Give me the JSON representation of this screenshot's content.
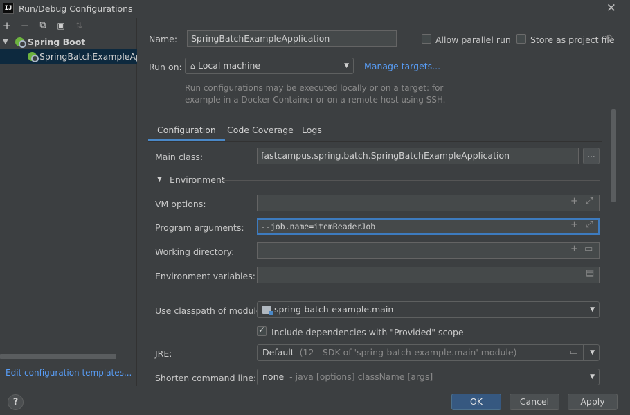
{
  "window": {
    "title": "Run/Debug Configurations",
    "app_icon_text": "IJ",
    "close_label": "✕"
  },
  "left_panel": {
    "toolbar": {
      "add": "+",
      "remove": "−",
      "copy": "⧉",
      "new_folder": "▣",
      "sort": "⇅"
    },
    "tree": {
      "group_label": "Spring Boot",
      "items": [
        {
          "label": "SpringBatchExampleApplication",
          "selected": true
        }
      ]
    },
    "edit_templates_link": "Edit configuration templates..."
  },
  "header": {
    "name_label": "Name:",
    "name_value": "SpringBatchExampleApplication",
    "allow_parallel_label": "Allow parallel run",
    "allow_parallel_checked": false,
    "store_project_label": "Store as project file",
    "store_project_checked": false,
    "run_on_label": "Run on:",
    "run_on_value": "Local machine",
    "manage_targets_link": "Manage targets...",
    "hint_line1": "Run configurations may be executed locally or on a target: for",
    "hint_line2": "example in a Docker Container or on a remote host using SSH."
  },
  "tabs": [
    {
      "label": "Configuration",
      "active": true
    },
    {
      "label": "Code Coverage",
      "active": false
    },
    {
      "label": "Logs",
      "active": false
    }
  ],
  "configuration": {
    "main_class_label": "Main class:",
    "main_class_value": "fastcampus.spring.batch.SpringBatchExampleApplication",
    "browse_button": "...",
    "environment_section": "Environment",
    "vm_options_label": "VM options:",
    "vm_options_value": "",
    "program_args_label": "Program arguments:",
    "program_args_before_caret": "--job.name=itemReader",
    "program_args_after_caret": "Job",
    "working_dir_label": "Working directory:",
    "working_dir_value": "",
    "env_vars_label": "Environment variables:",
    "env_vars_value": "",
    "classpath_label": "Use classpath of module:",
    "classpath_value": "spring-batch-example.main",
    "include_deps_label": "Include dependencies with \"Provided\" scope",
    "include_deps_checked": true,
    "jre_label": "JRE:",
    "jre_value": "Default",
    "jre_detail": "(12 - SDK of 'spring-batch-example.main' module)",
    "shorten_label": "Shorten command line:",
    "shorten_value": "none",
    "shorten_detail": "- java [options] className [args]"
  },
  "footer": {
    "help": "?",
    "ok": "OK",
    "cancel": "Cancel",
    "apply": "Apply"
  },
  "colors": {
    "background": "#3c3f41",
    "accent": "#4a88c7",
    "link": "#589df6",
    "primary_button": "#365880",
    "selection": "#0d293e"
  }
}
